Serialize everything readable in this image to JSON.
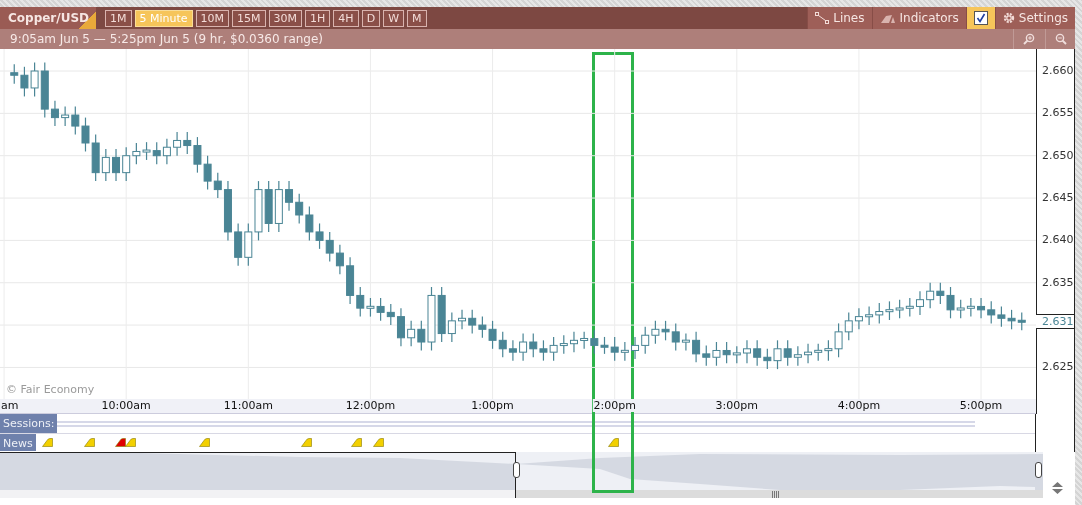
{
  "toolbar": {
    "symbol": "Copper/USD",
    "timeframes": [
      {
        "label": "1M",
        "selected": false
      },
      {
        "label": "5 Minute",
        "selected": true
      },
      {
        "label": "10M",
        "selected": false
      },
      {
        "label": "15M",
        "selected": false
      },
      {
        "label": "30M",
        "selected": false
      },
      {
        "label": "1H",
        "selected": false
      },
      {
        "label": "4H",
        "selected": false
      },
      {
        "label": "D",
        "selected": false
      },
      {
        "label": "W",
        "selected": false
      },
      {
        "label": "M",
        "selected": false
      }
    ],
    "tools": [
      {
        "kind": "lines",
        "label": "Lines"
      },
      {
        "kind": "indicators",
        "label": "Indicators"
      },
      {
        "kind": "checkbox",
        "checked": true
      },
      {
        "kind": "settings",
        "label": "Settings"
      }
    ]
  },
  "range_bar": {
    "text": "9:05am Jun 5 — 5:25pm Jun 5 (9 hr, $0.0360 range)"
  },
  "chart": {
    "last_price": "2.631",
    "copyright": "© Fair Economy",
    "chart_data": {
      "type": "candlestick",
      "grid": true,
      "xlim": [
        538,
        1047
      ],
      "ylim": [
        2.6195,
        2.6626
      ],
      "x": [
        545,
        550,
        555,
        560,
        565,
        570,
        575,
        580,
        585,
        590,
        595,
        600,
        605,
        610,
        615,
        620,
        625,
        630,
        635,
        640,
        645,
        650,
        655,
        660,
        665,
        670,
        675,
        680,
        685,
        690,
        695,
        700,
        705,
        710,
        715,
        720,
        725,
        730,
        735,
        740,
        745,
        750,
        755,
        760,
        765,
        770,
        775,
        780,
        785,
        790,
        795,
        800,
        805,
        810,
        815,
        820,
        825,
        830,
        835,
        840,
        845,
        850,
        855,
        860,
        865,
        870,
        875,
        880,
        885,
        890,
        895,
        900,
        905,
        910,
        915,
        920,
        925,
        930,
        935,
        940,
        945,
        950,
        955,
        960,
        965,
        970,
        975,
        980,
        985,
        990,
        995,
        1000,
        1005,
        1010,
        1015,
        1020,
        1025,
        1030,
        1035,
        1040
      ],
      "ohlc": [
        [
          2.6598,
          2.6608,
          2.6585,
          2.6595
        ],
        [
          2.6595,
          2.6605,
          2.657,
          2.658
        ],
        [
          2.658,
          2.661,
          2.657,
          2.66
        ],
        [
          2.66,
          2.661,
          2.6545,
          2.6555
        ],
        [
          2.6555,
          2.6565,
          2.6535,
          2.6545
        ],
        [
          2.6545,
          2.6558,
          2.6535,
          2.6548
        ],
        [
          2.6548,
          2.6558,
          2.6525,
          2.6535
        ],
        [
          2.6535,
          2.6545,
          2.6505,
          2.6515
        ],
        [
          2.6515,
          2.6525,
          2.647,
          2.648
        ],
        [
          2.648,
          2.6508,
          2.647,
          2.6498
        ],
        [
          2.6498,
          2.6508,
          2.647,
          2.648
        ],
        [
          2.648,
          2.651,
          2.647,
          2.65
        ],
        [
          2.65,
          2.6515,
          2.649,
          2.6505
        ],
        [
          2.6505,
          2.6516,
          2.6495,
          2.6506
        ],
        [
          2.6506,
          2.6516,
          2.649,
          2.65
        ],
        [
          2.65,
          2.652,
          2.649,
          2.651
        ],
        [
          2.651,
          2.6528,
          2.65,
          2.6518
        ],
        [
          2.6518,
          2.6528,
          2.6502,
          2.6512
        ],
        [
          2.6512,
          2.6522,
          2.648,
          2.649
        ],
        [
          2.649,
          2.65,
          2.646,
          2.647
        ],
        [
          2.647,
          2.648,
          2.645,
          2.646
        ],
        [
          2.646,
          2.647,
          2.64,
          2.641
        ],
        [
          2.641,
          2.642,
          2.637,
          2.638
        ],
        [
          2.638,
          2.642,
          2.637,
          2.641
        ],
        [
          2.641,
          2.647,
          2.64,
          2.646
        ],
        [
          2.646,
          2.647,
          2.641,
          2.642
        ],
        [
          2.642,
          2.647,
          2.641,
          2.646
        ],
        [
          2.646,
          2.647,
          2.6435,
          2.6445
        ],
        [
          2.6445,
          2.6455,
          2.642,
          2.643
        ],
        [
          2.643,
          2.644,
          2.64,
          2.641
        ],
        [
          2.641,
          2.642,
          2.639,
          2.64
        ],
        [
          2.64,
          2.641,
          2.6375,
          2.6385
        ],
        [
          2.6385,
          2.6395,
          2.636,
          2.637
        ],
        [
          2.637,
          2.638,
          2.6325,
          2.6335
        ],
        [
          2.6335,
          2.6345,
          2.631,
          2.632
        ],
        [
          2.632,
          2.6332,
          2.631,
          2.6322
        ],
        [
          2.6322,
          2.6332,
          2.6305,
          2.6315
        ],
        [
          2.6315,
          2.6325,
          2.63,
          2.631
        ],
        [
          2.631,
          2.632,
          2.6275,
          2.6285
        ],
        [
          2.6285,
          2.6305,
          2.6275,
          2.6295
        ],
        [
          2.6295,
          2.6305,
          2.627,
          2.628
        ],
        [
          2.628,
          2.6345,
          2.627,
          2.6335
        ],
        [
          2.6335,
          2.6345,
          2.628,
          2.629
        ],
        [
          2.629,
          2.6315,
          2.628,
          2.6305
        ],
        [
          2.6305,
          2.6318,
          2.6295,
          2.6308
        ],
        [
          2.6308,
          2.6318,
          2.629,
          2.63
        ],
        [
          2.63,
          2.631,
          2.6285,
          2.6295
        ],
        [
          2.6295,
          2.6305,
          2.6272,
          2.6282
        ],
        [
          2.6282,
          2.6292,
          2.6262,
          2.6272
        ],
        [
          2.6272,
          2.6282,
          2.6258,
          2.6268
        ],
        [
          2.6268,
          2.629,
          2.6258,
          2.628
        ],
        [
          2.628,
          2.629,
          2.6262,
          2.6272
        ],
        [
          2.6272,
          2.6282,
          2.6258,
          2.6268
        ],
        [
          2.6268,
          2.6286,
          2.6258,
          2.6276
        ],
        [
          2.6276,
          2.6288,
          2.6266,
          2.6278
        ],
        [
          2.6278,
          2.6292,
          2.6268,
          2.6282
        ],
        [
          2.6282,
          2.6292,
          2.6272,
          2.6284
        ],
        [
          2.6284,
          2.6294,
          2.6266,
          2.6276
        ],
        [
          2.6276,
          2.6286,
          2.6266,
          2.6274
        ],
        [
          2.6274,
          2.6286,
          2.6258,
          2.6268
        ],
        [
          2.6268,
          2.628,
          2.6258,
          2.627
        ],
        [
          2.627,
          2.6286,
          2.626,
          2.6276
        ],
        [
          2.6276,
          2.6298,
          2.6266,
          2.6288
        ],
        [
          2.6288,
          2.6305,
          2.6278,
          2.6295
        ],
        [
          2.6295,
          2.6305,
          2.6282,
          2.6292
        ],
        [
          2.6292,
          2.6302,
          2.627,
          2.628
        ],
        [
          2.628,
          2.629,
          2.627,
          2.6282
        ],
        [
          2.6282,
          2.6292,
          2.6256,
          2.6266
        ],
        [
          2.6266,
          2.6276,
          2.6252,
          2.6262
        ],
        [
          2.6262,
          2.628,
          2.6252,
          2.627
        ],
        [
          2.627,
          2.628,
          2.6255,
          2.6265
        ],
        [
          2.6265,
          2.6275,
          2.6255,
          2.6267
        ],
        [
          2.6267,
          2.6282,
          2.6255,
          2.6272
        ],
        [
          2.6272,
          2.6282,
          2.6252,
          2.6262
        ],
        [
          2.6262,
          2.6272,
          2.6248,
          2.6258
        ],
        [
          2.6258,
          2.6282,
          2.6248,
          2.6272
        ],
        [
          2.6272,
          2.6282,
          2.6252,
          2.6262
        ],
        [
          2.6262,
          2.6275,
          2.6252,
          2.6265
        ],
        [
          2.6265,
          2.6278,
          2.6255,
          2.6268
        ],
        [
          2.6268,
          2.6278,
          2.6258,
          2.627
        ],
        [
          2.627,
          2.6282,
          2.6258,
          2.6272
        ],
        [
          2.6272,
          2.6302,
          2.6262,
          2.6292
        ],
        [
          2.6292,
          2.6315,
          2.6282,
          2.6305
        ],
        [
          2.6305,
          2.632,
          2.6295,
          2.631
        ],
        [
          2.631,
          2.6322,
          2.63,
          2.6312
        ],
        [
          2.6312,
          2.6326,
          2.6302,
          2.6316
        ],
        [
          2.6316,
          2.6328,
          2.6306,
          2.6318
        ],
        [
          2.6318,
          2.633,
          2.6308,
          2.632
        ],
        [
          2.632,
          2.6332,
          2.631,
          2.6322
        ],
        [
          2.6322,
          2.634,
          2.6312,
          2.633
        ],
        [
          2.633,
          2.635,
          2.632,
          2.634
        ],
        [
          2.634,
          2.635,
          2.6325,
          2.6335
        ],
        [
          2.6335,
          2.6345,
          2.6308,
          2.6318
        ],
        [
          2.6318,
          2.633,
          2.6308,
          2.632
        ],
        [
          2.632,
          2.6332,
          2.631,
          2.6322
        ],
        [
          2.6322,
          2.6332,
          2.6308,
          2.6318
        ],
        [
          2.6318,
          2.6328,
          2.6302,
          2.6312
        ],
        [
          2.6312,
          2.6322,
          2.6298,
          2.6308
        ],
        [
          2.6308,
          2.6318,
          2.6295,
          2.6305
        ],
        [
          2.6305,
          2.6315,
          2.6294,
          2.6304
        ]
      ],
      "xticks": [
        {
          "value": 540,
          "label": "am"
        },
        {
          "value": 600,
          "label": "10:00am"
        },
        {
          "value": 660,
          "label": "11:00am"
        },
        {
          "value": 720,
          "label": "12:00pm"
        },
        {
          "value": 780,
          "label": "1:00pm"
        },
        {
          "value": 840,
          "label": "2:00pm"
        },
        {
          "value": 900,
          "label": "3:00pm"
        },
        {
          "value": 960,
          "label": "4:00pm"
        },
        {
          "value": 1020,
          "label": "5:00pm"
        }
      ],
      "yticks": [
        {
          "value": 2.66,
          "label": "2.660"
        },
        {
          "value": 2.655,
          "label": "2.655"
        },
        {
          "value": 2.65,
          "label": "2.650"
        },
        {
          "value": 2.645,
          "label": "2.645"
        },
        {
          "value": 2.64,
          "label": "2.640"
        },
        {
          "value": 2.635,
          "label": "2.635"
        },
        {
          "value": 2.625,
          "label": "2.625"
        }
      ]
    }
  },
  "sessions": {
    "label": "Sessions:"
  },
  "news": {
    "label": "News",
    "markers": [
      {
        "color": "#f2d000"
      },
      {
        "color": "#f2d000"
      },
      {
        "color": "#e00000"
      },
      {
        "color": "#f2d000"
      },
      {
        "color": "#f2d000"
      },
      {
        "color": "#f2d000"
      },
      {
        "color": "#f2d000"
      },
      {
        "color": "#f2d000"
      },
      {
        "color": "#f2d000"
      }
    ]
  }
}
